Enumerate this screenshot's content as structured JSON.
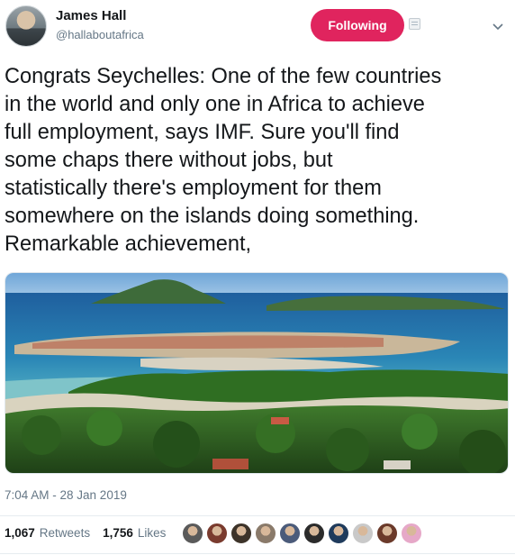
{
  "author": {
    "name": "James Hall",
    "handle": "@hallaboutafrica",
    "avatar_icon": "user-avatar"
  },
  "follow_button": {
    "label": "Following",
    "color": "#e0245e"
  },
  "tweet": {
    "text": "Congrats Seychelles: One of the few countries\nin the world and only one in Africa to achieve\nfull employment, says IMF. Sure you'll find\nsome chaps there without jobs, but\nstatistically there's employment for them\nsomewhere on the islands doing something.\nRemarkable achievement,",
    "timestamp": "7:04 AM - 28 Jan 2019"
  },
  "stats": {
    "retweets_count": "1,067",
    "retweets_label": "Retweets",
    "likes_count": "1,756",
    "likes_label": "Likes"
  },
  "likers": [
    {
      "color": "#5a5a5a"
    },
    {
      "color": "#7a3b2e"
    },
    {
      "color": "#3d3329"
    },
    {
      "color": "#8a7a6a"
    },
    {
      "color": "#4b5b7a"
    },
    {
      "color": "#2b2b2b"
    },
    {
      "color": "#1f3b5c"
    },
    {
      "color": "#c9c9c9"
    },
    {
      "color": "#6b3a2a"
    },
    {
      "color": "#e6a8c8"
    }
  ],
  "colors": {
    "text_primary": "#14171a",
    "text_secondary": "#657786",
    "accent": "#e0245e"
  }
}
